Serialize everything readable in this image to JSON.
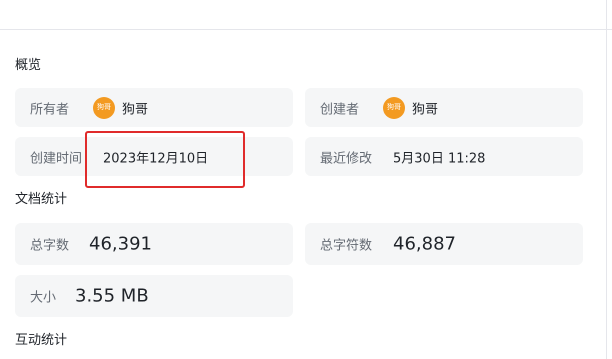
{
  "sections": {
    "overview": "概览",
    "doc_stats": "文档统计",
    "interaction_stats": "互动统计"
  },
  "owner": {
    "label": "所有者",
    "avatar_text": "狗哥",
    "name": "狗哥"
  },
  "creator": {
    "label": "创建者",
    "avatar_text": "狗哥",
    "name": "狗哥"
  },
  "created_time": {
    "label": "创建时间",
    "value": "2023年12月10日"
  },
  "last_modified": {
    "label": "最近修改",
    "value": "5月30日 11:28"
  },
  "total_chars": {
    "label": "总字数",
    "value": "46,391"
  },
  "total_symbols": {
    "label": "总字符数",
    "value": "46,887"
  },
  "size": {
    "label": "大小",
    "value": "3.55 MB"
  },
  "colors": {
    "card_bg": "#f5f6f7",
    "avatar": "#f39a21",
    "highlight": "#e02b2b"
  }
}
